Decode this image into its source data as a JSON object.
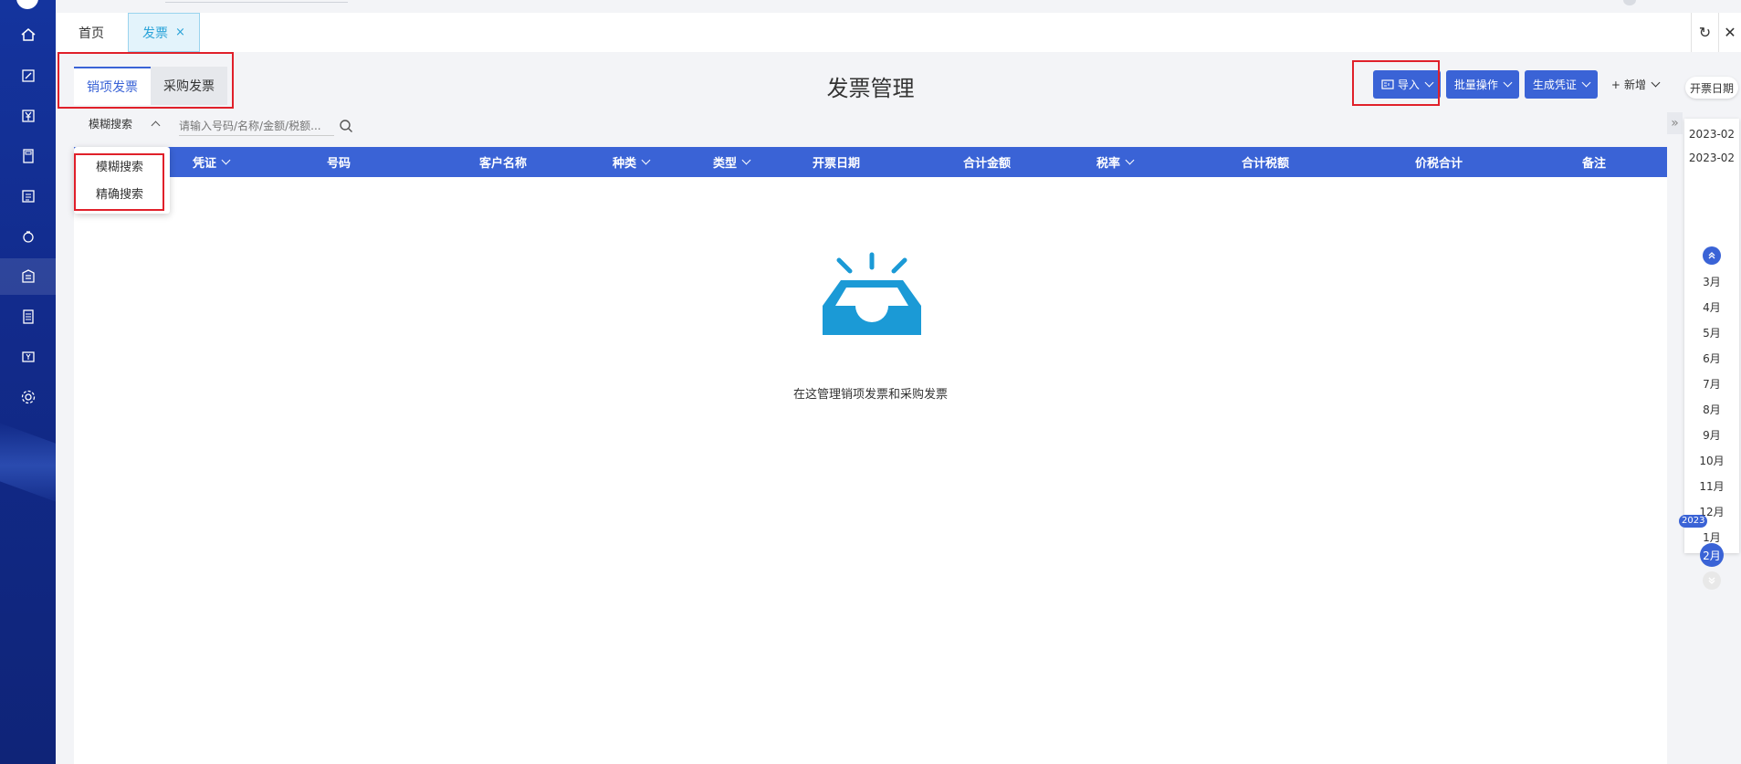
{
  "tabs": {
    "home": "首页",
    "invoice": "发票",
    "close": "×"
  },
  "sub_tabs": [
    "销项发票",
    "采购发票"
  ],
  "page_title": "发票管理",
  "toolbar": {
    "import": "导入",
    "batch": "批量操作",
    "voucher": "生成凭证",
    "add": "新增"
  },
  "search": {
    "mode": "模糊搜索",
    "placeholder": "请输入号码/名称/金额/税额..."
  },
  "dropdown": [
    "模糊搜索",
    "精确搜索"
  ],
  "columns": [
    "凭证",
    "号码",
    "客户名称",
    "种类",
    "类型",
    "开票日期",
    "合计金额",
    "税率",
    "合计税额",
    "价税合计",
    "备注"
  ],
  "empty_text": "在这管理销项发票和采购发票",
  "date_panel": {
    "label": "开票日期",
    "start": "2023-02",
    "end": "2023-02",
    "months": [
      "3月",
      "4月",
      "5月",
      "6月",
      "7月",
      "8月",
      "9月",
      "10月",
      "11月",
      "12月",
      "1月"
    ],
    "year": "2023",
    "active_month": "2月"
  },
  "colors": {
    "accent": "#3a63d6",
    "sidebar": "#14349e",
    "annotation": "#e0202a"
  }
}
